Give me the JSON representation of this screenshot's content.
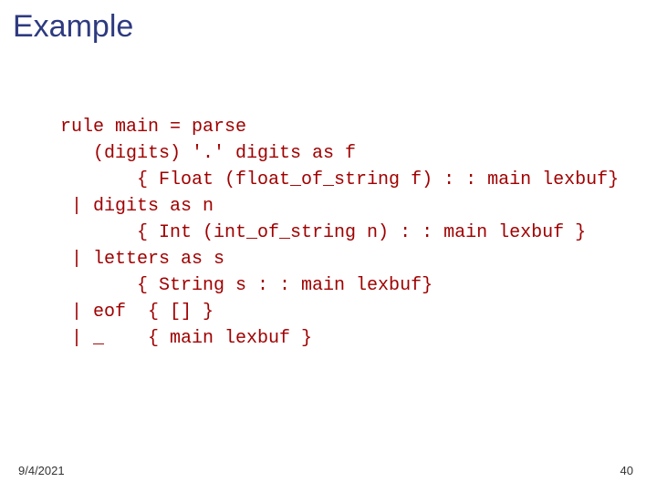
{
  "title": "Example",
  "code_lines": {
    "l0": " rule main = parse",
    "l1": "    (digits) '.' digits as f",
    "l2": "        { Float (float_of_string f) : : main lexbuf}",
    "l3": "  | digits as n",
    "l4": "        { Int (int_of_string n) : : main lexbuf }",
    "l5": "  | letters as s",
    "l6": "        { String s : : main lexbuf}",
    "l7": "  | eof  { [] }",
    "l8": "  | _    { main lexbuf }"
  },
  "footer": {
    "date": "9/4/2021",
    "page": "40"
  }
}
